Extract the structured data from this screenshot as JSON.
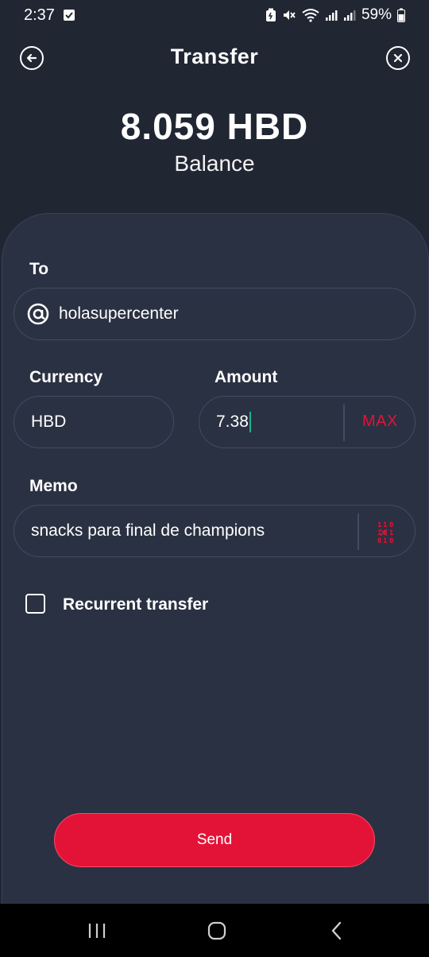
{
  "status_bar": {
    "time": "2:37",
    "battery": "59%"
  },
  "header": {
    "title": "Transfer",
    "back_icon": "arrow-left-circle-icon",
    "close_icon": "close-circle-icon"
  },
  "balance": {
    "amount": "8.059 HBD",
    "label": "Balance"
  },
  "form": {
    "to": {
      "label": "To",
      "icon": "at-icon",
      "value": "holasupercenter"
    },
    "currency": {
      "label": "Currency",
      "value": "HBD"
    },
    "amount": {
      "label": "Amount",
      "value": "7.38",
      "max_label": "MAX"
    },
    "memo": {
      "label": "Memo",
      "value": "snacks para final de champions",
      "encrypt_icon": "binary-encrypt-icon"
    },
    "recurrent": {
      "label": "Recurrent transfer",
      "checked": false
    }
  },
  "send_button": {
    "label": "Send"
  },
  "colors": {
    "background": "#212633",
    "card": "#2a3142",
    "accent": "#e31337",
    "caret": "#1fb28a"
  },
  "nav_bar": {
    "recent_icon": "recent-apps-icon",
    "home_icon": "home-icon",
    "back_icon": "back-chevron-icon"
  }
}
